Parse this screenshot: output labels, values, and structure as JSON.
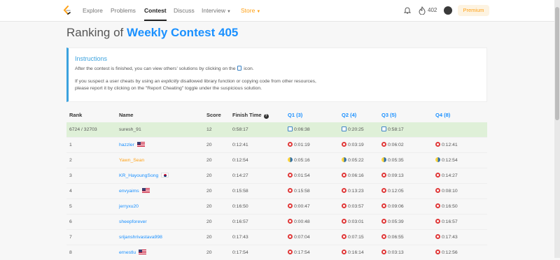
{
  "nav": {
    "items": [
      {
        "label": "Explore"
      },
      {
        "label": "Problems"
      },
      {
        "label": "Contest"
      },
      {
        "label": "Discuss"
      },
      {
        "label": "Interview"
      },
      {
        "label": "Store"
      }
    ],
    "points": "402",
    "premium_label": "Premium",
    "colors": {
      "brand": "#ffa116",
      "link": "#1a90ff",
      "highlight_row": "#dff0d8"
    }
  },
  "page": {
    "title_prefix": "Ranking of",
    "contest_name": "Weekly Contest 405"
  },
  "instructions": {
    "title": "Instructions",
    "line1_before": "After the contest is finished, you can view others' solutions by clicking on the",
    "line1_after": "icon.",
    "line2_a": "If you suspect a user cheats by using an",
    "line2_em": "explicitly",
    "line2_b": "disallowed library function or copying code from other resources,",
    "line3": "please report it by clicking on the \"Report Cheating\" toggle under the suspicious solution."
  },
  "table": {
    "headers": {
      "rank": "Rank",
      "name": "Name",
      "score": "Score",
      "finish": "Finish Time",
      "q1": "Q1 (3)",
      "q2": "Q2 (4)",
      "q3": "Q3 (5)",
      "q4": "Q4 (8)"
    },
    "me": {
      "rank": "6724 / 32703",
      "name": "suresh_91",
      "score": "12",
      "finish": "0:58:17",
      "q1": "0:06:38",
      "q2": "0:20:25",
      "q3": "0:58:17",
      "q4": "",
      "lang": "doc"
    },
    "rows": [
      {
        "rank": "1",
        "name": "hazzler",
        "flag": "us",
        "score": "20",
        "finish": "0:12:41",
        "q1": "0:01:19",
        "q2": "0:03:19",
        "q3": "0:06:02",
        "q4": "0:12:41",
        "lang": "cpp"
      },
      {
        "rank": "2",
        "name": "Yawn_Sean",
        "flag": "",
        "score": "20",
        "finish": "0:12:54",
        "q1": "0:05:16",
        "q2": "0:05:22",
        "q3": "0:05:35",
        "q4": "0:12:54",
        "lang": "py"
      },
      {
        "rank": "3",
        "name": "KR_HayoungSong",
        "flag": "kr",
        "score": "20",
        "finish": "0:14:27",
        "q1": "0:01:54",
        "q2": "0:06:16",
        "q3": "0:09:13",
        "q4": "0:14:27",
        "lang": "cpp"
      },
      {
        "rank": "4",
        "name": "envyaims",
        "flag": "us",
        "score": "20",
        "finish": "0:15:58",
        "q1": "0:15:58",
        "q2": "0:13:23",
        "q3": "0:12:05",
        "q4": "0:08:10",
        "lang": "cpp"
      },
      {
        "rank": "5",
        "name": "jerryxu20",
        "flag": "",
        "score": "20",
        "finish": "0:16:50",
        "q1": "0:00:47",
        "q2": "0:03:57",
        "q3": "0:09:06",
        "q4": "0:16:50",
        "lang": "cpp"
      },
      {
        "rank": "6",
        "name": "sheepforever",
        "flag": "",
        "score": "20",
        "finish": "0:16:57",
        "q1": "0:00:48",
        "q2": "0:03:01",
        "q3": "0:05:39",
        "q4": "0:16:57",
        "lang": "cpp"
      },
      {
        "rank": "7",
        "name": "srijanshrivastava998",
        "flag": "",
        "score": "20",
        "finish": "0:17:43",
        "q1": "0:07:04",
        "q2": "0:07:15",
        "q3": "0:06:55",
        "q4": "0:17:43",
        "lang": "cpp"
      },
      {
        "rank": "8",
        "name": "ernestlu",
        "flag": "us",
        "score": "20",
        "finish": "0:17:54",
        "q1": "0:17:54",
        "q2": "0:16:14",
        "q3": "0:03:13",
        "q4": "0:12:56",
        "lang": "cpp"
      }
    ]
  }
}
